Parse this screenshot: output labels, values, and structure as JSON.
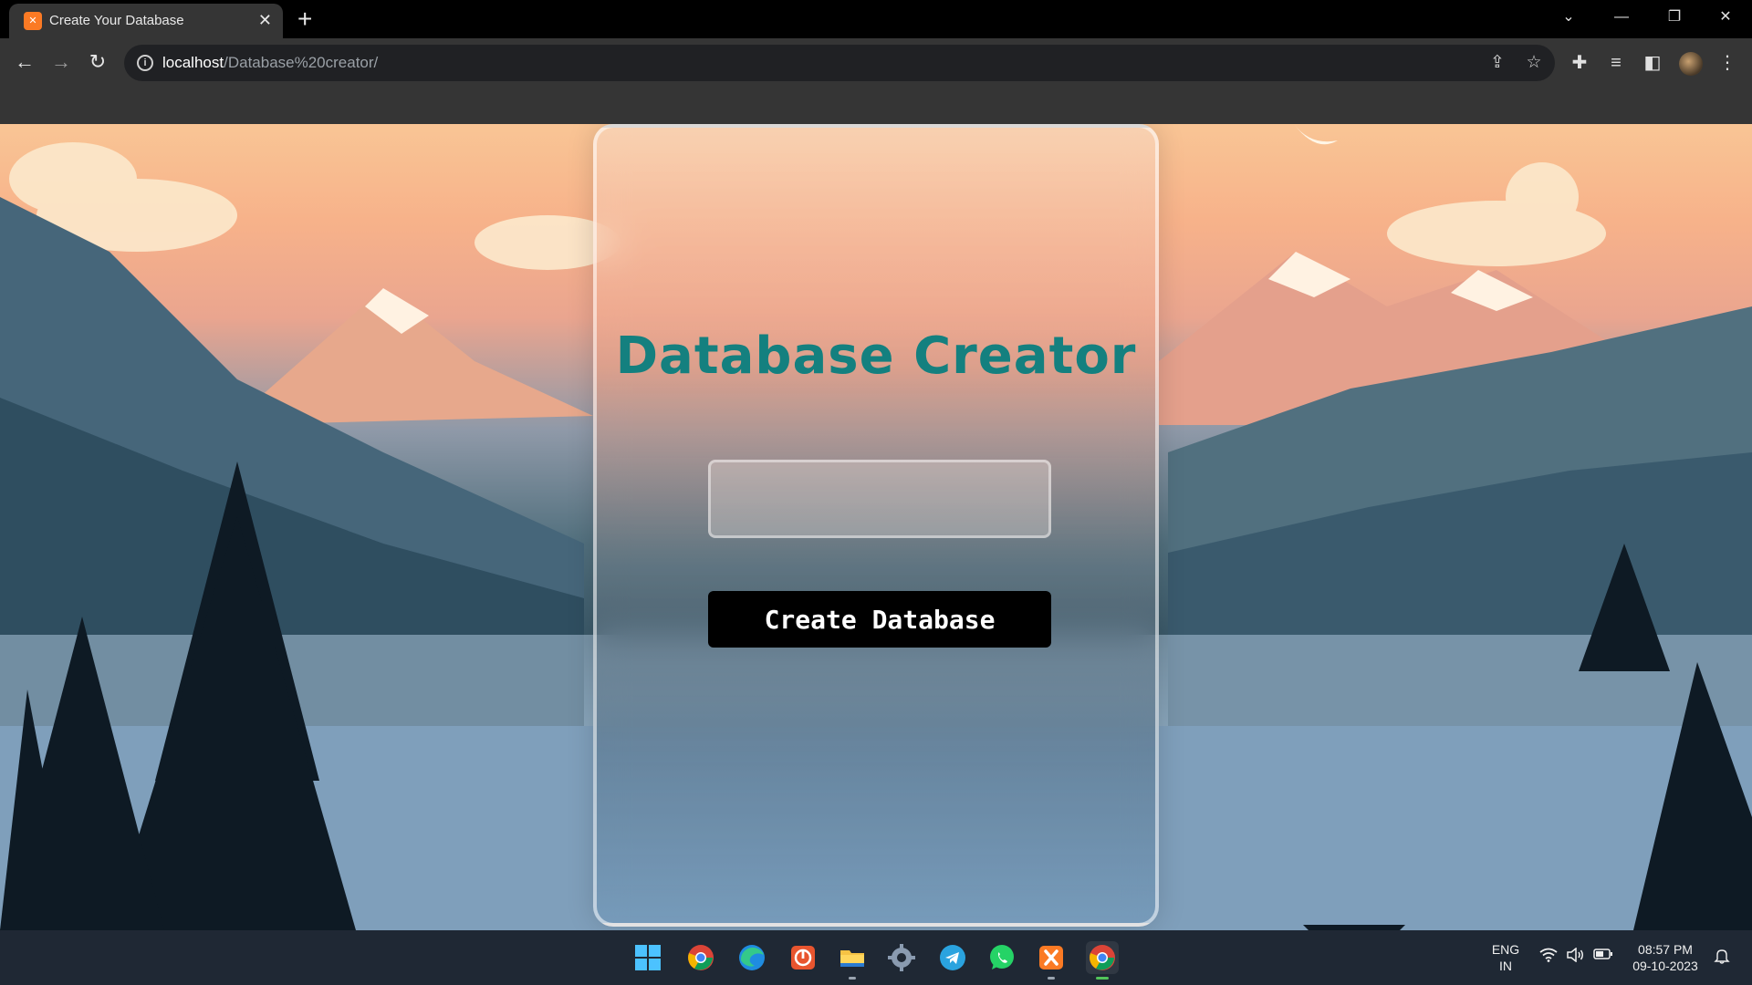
{
  "browser": {
    "tab_title": "Create Your Database",
    "tab_favicon": "xampp-icon",
    "url_host": "localhost",
    "url_path": "/Database%20creator/"
  },
  "page": {
    "heading": "Database Creator",
    "input_value": "",
    "button_label": "Create Database",
    "heading_color": "#14807f",
    "button_color": "#000000"
  },
  "taskbar": {
    "apps": [
      "start-icon",
      "chrome-icon",
      "edge-icon",
      "power-app-icon",
      "file-explorer-icon",
      "settings-icon",
      "telegram-icon",
      "whatsapp-icon",
      "xampp-icon",
      "chrome-icon"
    ],
    "lang_primary": "ENG",
    "lang_secondary": "IN",
    "time": "08:57 PM",
    "date": "09-10-2023"
  }
}
